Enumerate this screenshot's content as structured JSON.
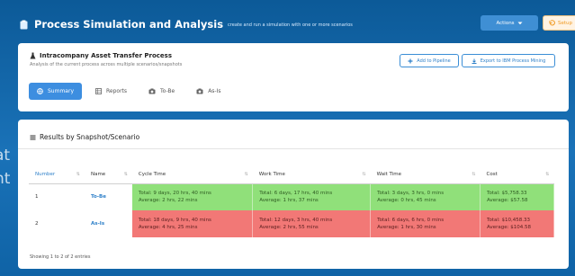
{
  "background": {
    "lines": [
      "at",
      "nt"
    ]
  },
  "header": {
    "title": "Process Simulation and Analysis",
    "subtitle": "create and run a simulation with one or more scenarios",
    "actions_label": "Actions",
    "setup_label": "Setup"
  },
  "process": {
    "title": "Intracompany Asset Transfer Process",
    "subtitle": "Analysis of the current process across multiple scenarios/snapshots",
    "add_pipeline_label": "Add to Pipeline",
    "export_label": "Export to IBM Process Mining"
  },
  "tabs": [
    {
      "label": "Summary",
      "active": true
    },
    {
      "label": "Reports",
      "active": false
    },
    {
      "label": "To-Be",
      "active": false
    },
    {
      "label": "As-Is",
      "active": false
    }
  ],
  "results": {
    "title": "Results by Snapshot/Scenario",
    "columns": [
      "Number",
      "Name",
      "Cycle Time",
      "Work Time",
      "Wait Time",
      "Cost"
    ],
    "rows": [
      {
        "number": "1",
        "name": "To-Be",
        "cycle_total": "Total: 9 days, 20 hrs, 40 mins",
        "cycle_avg": "Average: 2 hrs, 22 mins",
        "work_total": "Total: 6 days, 17 hrs, 40 mins",
        "work_avg": "Average: 1 hrs, 37 mins",
        "wait_total": "Total: 3 days, 3 hrs, 0 mins",
        "wait_avg": "Average: 0 hrs, 45 mins",
        "cost_total": "Total: $5,758.33",
        "cost_avg": "Average: $57.58"
      },
      {
        "number": "2",
        "name": "As-Is",
        "cycle_total": "Total: 18 days, 9 hrs, 40 mins",
        "cycle_avg": "Average: 4 hrs, 25 mins",
        "work_total": "Total: 12 days, 3 hrs, 40 mins",
        "work_avg": "Average: 2 hrs, 55 mins",
        "wait_total": "Total: 6 days, 6 hrs, 0 mins",
        "wait_avg": "Average: 1 hrs, 30 mins",
        "cost_total": "Total: $10,458.33",
        "cost_avg": "Average: $104.58"
      }
    ],
    "footer": "Showing 1 to 2 of 2 entries"
  },
  "colors": {
    "background": "#0e5fa0",
    "accent": "#3d8ee0",
    "better": "#90e07a",
    "worse": "#f27876",
    "setup": "#f09a22"
  },
  "icons": [
    "clipboard-icon",
    "chevron-down-icon",
    "undo-icon",
    "flask-icon",
    "plus-icon",
    "download-icon",
    "globe-icon",
    "table-icon",
    "camera-icon",
    "list-icon",
    "sort-icon"
  ]
}
